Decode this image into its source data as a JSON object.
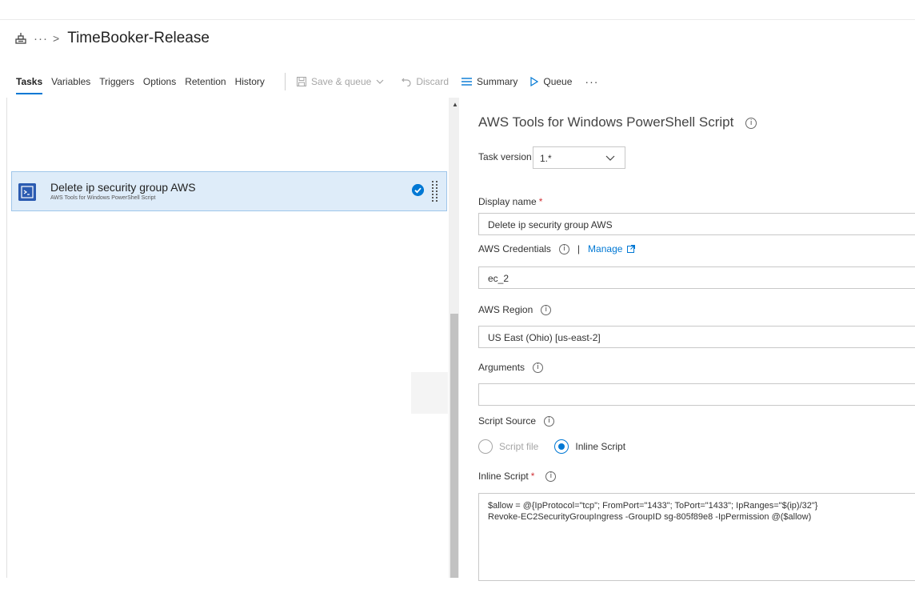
{
  "breadcrumb": {
    "ellipsis": "···",
    "separator": ">",
    "title": "TimeBooker-Release"
  },
  "tabs": [
    {
      "label": "Tasks",
      "active": true
    },
    {
      "label": "Variables"
    },
    {
      "label": "Triggers"
    },
    {
      "label": "Options"
    },
    {
      "label": "Retention"
    },
    {
      "label": "History"
    }
  ],
  "toolbar": {
    "save_queue": "Save & queue",
    "discard": "Discard",
    "summary": "Summary",
    "queue": "Queue",
    "more": "···"
  },
  "task": {
    "name": "Delete ip security group AWS",
    "subtitle": "AWS Tools for Windows PowerShell Script"
  },
  "panel": {
    "title": "AWS Tools for Windows PowerShell Script",
    "task_version_label": "Task version",
    "task_version_value": "1.*",
    "display_name_label": "Display name",
    "display_name_value": "Delete ip security group AWS",
    "aws_credentials_label": "AWS Credentials",
    "manage_label": "Manage",
    "aws_credentials_value": "ec_2",
    "aws_region_label": "AWS Region",
    "aws_region_value": "US East (Ohio) [us-east-2]",
    "arguments_label": "Arguments",
    "arguments_value": "",
    "script_source_label": "Script Source",
    "script_file_label": "Script file",
    "inline_script_option_label": "Inline Script",
    "selected_source": "Inline Script",
    "inline_script_label": "Inline Script",
    "inline_script_line1": "$allow = @{IpProtocol=\"tcp\"; FromPort=\"1433\"; ToPort=\"1433\"; IpRanges=\"$(ip)/32\"}",
    "inline_script_line2": "Revoke-EC2SecurityGroupIngress -GroupID sg-805f89e8 -IpPermission @($allow)",
    "required_marker": "*",
    "info_glyph": "i"
  },
  "colors": {
    "accent": "#0078d4",
    "selected_row": "#deecf9",
    "required": "#d13438"
  }
}
